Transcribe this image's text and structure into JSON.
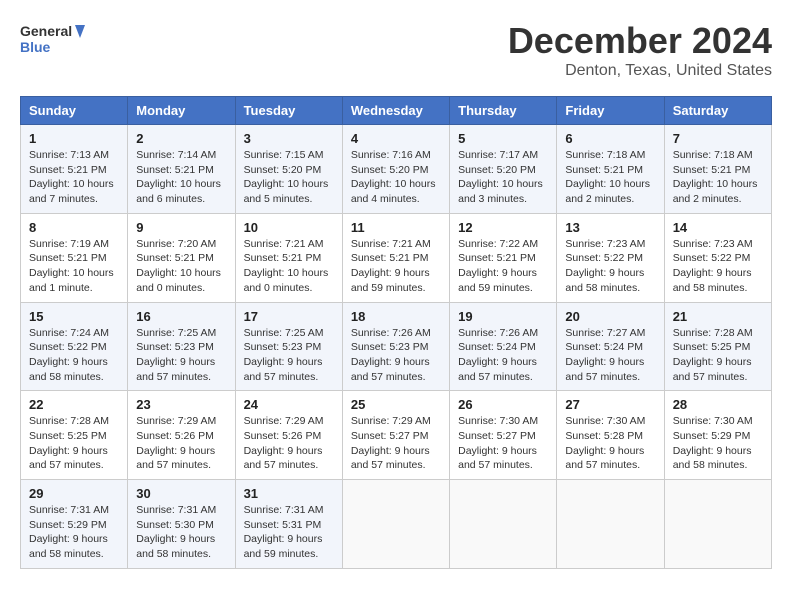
{
  "header": {
    "logo_line1": "General",
    "logo_line2": "Blue",
    "title": "December 2024",
    "subtitle": "Denton, Texas, United States"
  },
  "days_of_week": [
    "Sunday",
    "Monday",
    "Tuesday",
    "Wednesday",
    "Thursday",
    "Friday",
    "Saturday"
  ],
  "weeks": [
    [
      {
        "day": 1,
        "info": "Sunrise: 7:13 AM\nSunset: 5:21 PM\nDaylight: 10 hours and 7 minutes."
      },
      {
        "day": 2,
        "info": "Sunrise: 7:14 AM\nSunset: 5:21 PM\nDaylight: 10 hours and 6 minutes."
      },
      {
        "day": 3,
        "info": "Sunrise: 7:15 AM\nSunset: 5:20 PM\nDaylight: 10 hours and 5 minutes."
      },
      {
        "day": 4,
        "info": "Sunrise: 7:16 AM\nSunset: 5:20 PM\nDaylight: 10 hours and 4 minutes."
      },
      {
        "day": 5,
        "info": "Sunrise: 7:17 AM\nSunset: 5:20 PM\nDaylight: 10 hours and 3 minutes."
      },
      {
        "day": 6,
        "info": "Sunrise: 7:18 AM\nSunset: 5:21 PM\nDaylight: 10 hours and 2 minutes."
      },
      {
        "day": 7,
        "info": "Sunrise: 7:18 AM\nSunset: 5:21 PM\nDaylight: 10 hours and 2 minutes."
      }
    ],
    [
      {
        "day": 8,
        "info": "Sunrise: 7:19 AM\nSunset: 5:21 PM\nDaylight: 10 hours and 1 minute."
      },
      {
        "day": 9,
        "info": "Sunrise: 7:20 AM\nSunset: 5:21 PM\nDaylight: 10 hours and 0 minutes."
      },
      {
        "day": 10,
        "info": "Sunrise: 7:21 AM\nSunset: 5:21 PM\nDaylight: 10 hours and 0 minutes."
      },
      {
        "day": 11,
        "info": "Sunrise: 7:21 AM\nSunset: 5:21 PM\nDaylight: 9 hours and 59 minutes."
      },
      {
        "day": 12,
        "info": "Sunrise: 7:22 AM\nSunset: 5:21 PM\nDaylight: 9 hours and 59 minutes."
      },
      {
        "day": 13,
        "info": "Sunrise: 7:23 AM\nSunset: 5:22 PM\nDaylight: 9 hours and 58 minutes."
      },
      {
        "day": 14,
        "info": "Sunrise: 7:23 AM\nSunset: 5:22 PM\nDaylight: 9 hours and 58 minutes."
      }
    ],
    [
      {
        "day": 15,
        "info": "Sunrise: 7:24 AM\nSunset: 5:22 PM\nDaylight: 9 hours and 58 minutes."
      },
      {
        "day": 16,
        "info": "Sunrise: 7:25 AM\nSunset: 5:23 PM\nDaylight: 9 hours and 57 minutes."
      },
      {
        "day": 17,
        "info": "Sunrise: 7:25 AM\nSunset: 5:23 PM\nDaylight: 9 hours and 57 minutes."
      },
      {
        "day": 18,
        "info": "Sunrise: 7:26 AM\nSunset: 5:23 PM\nDaylight: 9 hours and 57 minutes."
      },
      {
        "day": 19,
        "info": "Sunrise: 7:26 AM\nSunset: 5:24 PM\nDaylight: 9 hours and 57 minutes."
      },
      {
        "day": 20,
        "info": "Sunrise: 7:27 AM\nSunset: 5:24 PM\nDaylight: 9 hours and 57 minutes."
      },
      {
        "day": 21,
        "info": "Sunrise: 7:28 AM\nSunset: 5:25 PM\nDaylight: 9 hours and 57 minutes."
      }
    ],
    [
      {
        "day": 22,
        "info": "Sunrise: 7:28 AM\nSunset: 5:25 PM\nDaylight: 9 hours and 57 minutes."
      },
      {
        "day": 23,
        "info": "Sunrise: 7:29 AM\nSunset: 5:26 PM\nDaylight: 9 hours and 57 minutes."
      },
      {
        "day": 24,
        "info": "Sunrise: 7:29 AM\nSunset: 5:26 PM\nDaylight: 9 hours and 57 minutes."
      },
      {
        "day": 25,
        "info": "Sunrise: 7:29 AM\nSunset: 5:27 PM\nDaylight: 9 hours and 57 minutes."
      },
      {
        "day": 26,
        "info": "Sunrise: 7:30 AM\nSunset: 5:27 PM\nDaylight: 9 hours and 57 minutes."
      },
      {
        "day": 27,
        "info": "Sunrise: 7:30 AM\nSunset: 5:28 PM\nDaylight: 9 hours and 57 minutes."
      },
      {
        "day": 28,
        "info": "Sunrise: 7:30 AM\nSunset: 5:29 PM\nDaylight: 9 hours and 58 minutes."
      }
    ],
    [
      {
        "day": 29,
        "info": "Sunrise: 7:31 AM\nSunset: 5:29 PM\nDaylight: 9 hours and 58 minutes."
      },
      {
        "day": 30,
        "info": "Sunrise: 7:31 AM\nSunset: 5:30 PM\nDaylight: 9 hours and 58 minutes."
      },
      {
        "day": 31,
        "info": "Sunrise: 7:31 AM\nSunset: 5:31 PM\nDaylight: 9 hours and 59 minutes."
      },
      null,
      null,
      null,
      null
    ]
  ]
}
